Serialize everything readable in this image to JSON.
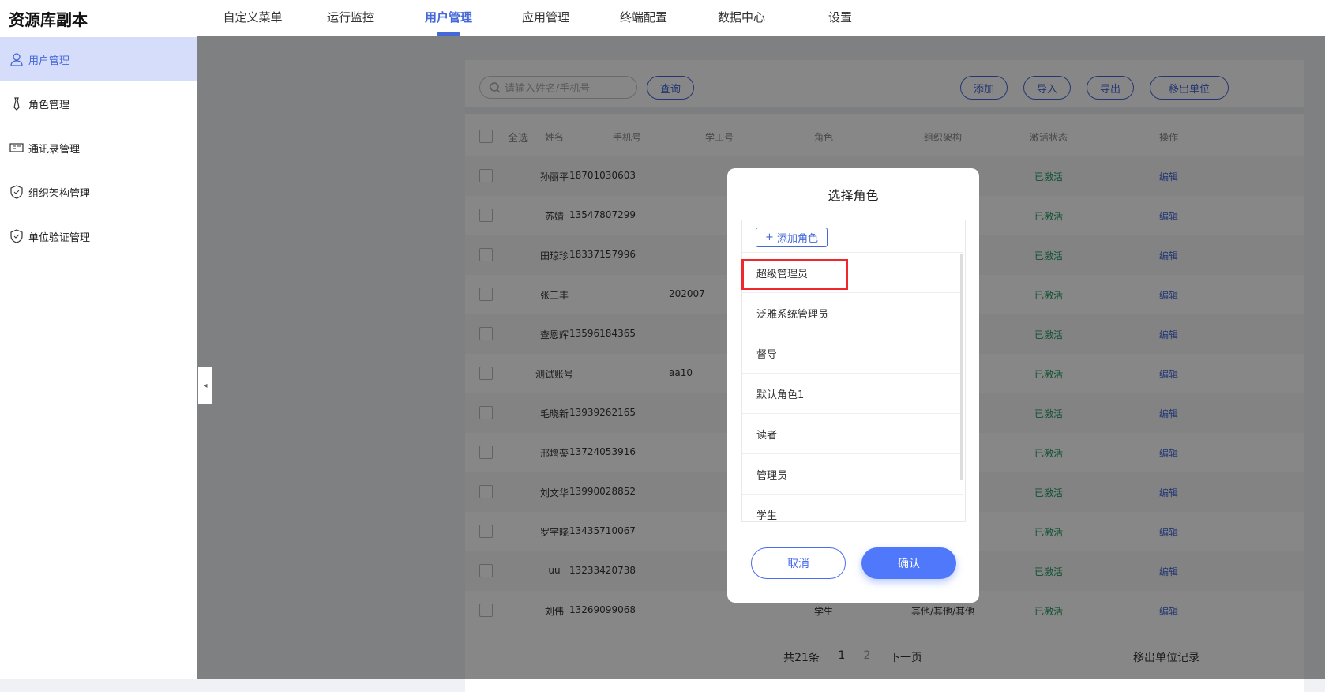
{
  "app_title": "资源库副本",
  "nav": [
    "自定义菜单",
    "运行监控",
    "用户管理",
    "应用管理",
    "终端配置",
    "数据中心",
    "设置"
  ],
  "sidebar": [
    {
      "label": "用户管理",
      "icon": "user-icon"
    },
    {
      "label": "角色管理",
      "icon": "tie-icon"
    },
    {
      "label": "通讯录管理",
      "icon": "contact-card-icon"
    },
    {
      "label": "组织架构管理",
      "icon": "shield-icon"
    },
    {
      "label": "单位验证管理",
      "icon": "shield-icon"
    }
  ],
  "toolbar": {
    "search_placeholder": "请输入姓名/手机号",
    "query": "查询",
    "add": "添加",
    "import": "导入",
    "export": "导出",
    "remove_unit": "移出单位"
  },
  "table": {
    "select_all": "全选",
    "headers": [
      "姓名",
      "手机号",
      "学工号",
      "角色",
      "组织架构",
      "激活状态",
      "操作"
    ],
    "rows": [
      {
        "name": "孙丽平",
        "phone": "18701030603",
        "id": "",
        "role": "",
        "org": "",
        "status": "已激活",
        "action": "编辑"
      },
      {
        "name": "苏婧",
        "phone": "13547807299",
        "id": "",
        "role": "",
        "org": "",
        "status": "已激活",
        "action": "编辑"
      },
      {
        "name": "田琼珍",
        "phone": "18337157996",
        "id": "",
        "role": "",
        "org": "",
        "status": "已激活",
        "action": "编辑"
      },
      {
        "name": "张三丰",
        "phone": "",
        "id": "202007",
        "role": "",
        "org": "",
        "status": "已激活",
        "action": "编辑"
      },
      {
        "name": "查恩辉",
        "phone": "13596184365",
        "id": "",
        "role": "",
        "org": "",
        "status": "已激活",
        "action": "编辑"
      },
      {
        "name": "测试账号",
        "phone": "",
        "id": "aa10",
        "role": "",
        "org": "",
        "status": "已激活",
        "action": "编辑"
      },
      {
        "name": "毛晓新",
        "phone": "13939262165",
        "id": "",
        "role": "",
        "org": "",
        "status": "已激活",
        "action": "编辑"
      },
      {
        "name": "邢增銮",
        "phone": "13724053916",
        "id": "",
        "role": "",
        "org": "",
        "status": "已激活",
        "action": "编辑"
      },
      {
        "name": "刘文华",
        "phone": "13990028852",
        "id": "",
        "role": "",
        "org": "",
        "status": "已激活",
        "action": "编辑"
      },
      {
        "name": "罗宇晓",
        "phone": "13435710067",
        "id": "",
        "role": "",
        "org": "",
        "status": "已激活",
        "action": "编辑"
      },
      {
        "name": "uu",
        "phone": "13233420738",
        "id": "",
        "role": "",
        "org": "",
        "status": "已激活",
        "action": "编辑"
      },
      {
        "name": "刘伟",
        "phone": "13269099068",
        "id": "",
        "role": "学生",
        "org": "其他/其他/其他",
        "status": "已激活",
        "action": "编辑"
      }
    ]
  },
  "pagination": {
    "total": "共21条",
    "pages": [
      "1",
      "2"
    ],
    "next": "下一页",
    "remove_records": "移出单位记录"
  },
  "modal": {
    "title": "选择角色",
    "add_role": "添加角色",
    "roles": [
      "超级管理员",
      "泛雅系统管理员",
      "督导",
      "默认角色1",
      "读者",
      "管理员",
      "学生"
    ],
    "cancel": "取消",
    "confirm": "确认"
  }
}
